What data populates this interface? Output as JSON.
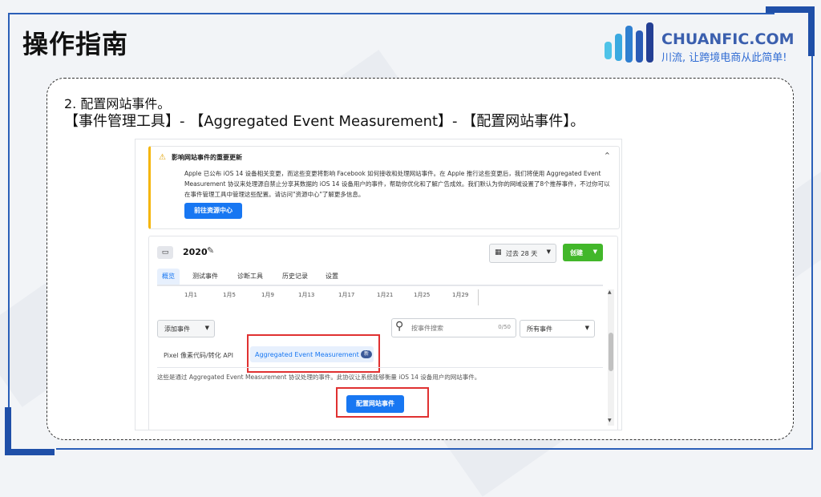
{
  "slide": {
    "title": "操作指南",
    "brand": {
      "name": "CHUANFIC.COM",
      "slogan": "川流, 让跨境电商从此简单!"
    },
    "step": "2. 配置网站事件。",
    "path": "【事件管理工具】- 【Aggregated Event Measurement】- 【配置网站事件】。",
    "colors": {
      "frame": "#2b5fb8",
      "highlight": "#e03131",
      "primary": "#1877f2",
      "create": "#42b72a"
    }
  },
  "screenshot": {
    "notice": {
      "title": "影响网站事件的重要更新",
      "body": "Apple 已公布 iOS 14 设备相关变更，而这些变更将影响 Facebook 如何接收和处理网站事件。在 Apple 推行这些变更后，我们将使用 Aggregated Event Measurement 协议来处理源自禁止分享其数据的 iOS 14 设备用户的事件，帮助你优化和了解广告成效。我们默认为你的网域设置了8个推荐事件，不过你可以在事件管理工具中管理这些配置。请访问\"资源中心\"了解更多信息。",
      "button": "前往资源中心",
      "icon": "warning-icon",
      "collapse_icon": "chevron-up-icon"
    },
    "dataset": {
      "name": "2020",
      "date_range": "过去 28 天",
      "create": "创建"
    },
    "tabs": [
      "概览",
      "测试事件",
      "诊断工具",
      "历史记录",
      "设置"
    ],
    "active_tab": "概览",
    "axis_dates": [
      "1月1",
      "1月5",
      "1月9",
      "1月13",
      "1月17",
      "1月21",
      "1月25",
      "1月29"
    ],
    "toolbar": {
      "add_event": "添加事件",
      "search_placeholder": "按事件搜索",
      "search_count": "0/50",
      "filter": "所有事件"
    },
    "subtabs": {
      "pixel": "Pixel 像素代码/转化 API",
      "aem": "Aggregated Event Measurement",
      "aem_badge": "新"
    },
    "description": "这些是通过 Aggregated Event Measurement 协议处理的事件。此协议让系统能够衡量 iOS 14 设备用户的网站事件。",
    "configure_button": "配置网站事件"
  }
}
